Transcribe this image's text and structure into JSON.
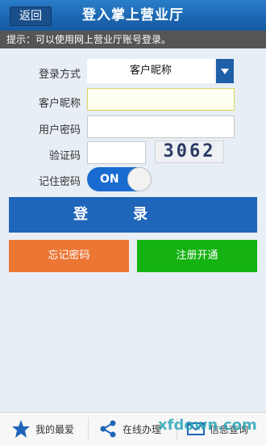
{
  "header": {
    "back_label": "返回",
    "title": "登入掌上营业厅"
  },
  "tip": "提示：可以使用网上营业厅账号登录。",
  "form": {
    "login_method_label": "登录方式",
    "login_method_value": "客户昵称",
    "nickname_label": "客户昵称",
    "nickname_value": "",
    "password_label": "用户密码",
    "password_value": "",
    "captcha_label": "验证码",
    "captcha_value": "",
    "captcha_text": "3062",
    "remember_label": "记住密码",
    "remember_state": "ON"
  },
  "buttons": {
    "login": "登录",
    "forgot": "忘记密码",
    "register": "注册开通"
  },
  "bottom_tabs": [
    {
      "label": "我的最爱",
      "icon": "star-icon"
    },
    {
      "label": "在线办理",
      "icon": "share-icon"
    },
    {
      "label": "信息查询",
      "icon": "mail-icon"
    }
  ],
  "watermark": "xfdown.com",
  "colors": {
    "header": "#1b66b1",
    "login": "#1f65b9",
    "forgot": "#ec7634",
    "register": "#14b312",
    "toggle": "#1a6bd0"
  }
}
